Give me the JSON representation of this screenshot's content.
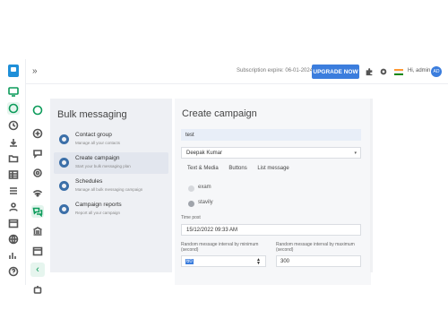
{
  "topbar": {
    "expand_icon": "double-chevron-right-icon",
    "subscription_text": "Subscription expire: 06-01-2024",
    "upgrade_label": "UPGRADE NOW",
    "greeting": "Hi, admin",
    "avatar_initials": "AD",
    "flag_colors": [
      "#ff9933",
      "#ffffff",
      "#138808"
    ]
  },
  "left_panel": {
    "title": "Bulk messaging",
    "items": [
      {
        "name": "Contact group",
        "desc": "Manage all your contacts"
      },
      {
        "name": "Create campaign",
        "desc": "Start your bulk messaging plan"
      },
      {
        "name": "Schedules",
        "desc": "Manage all bulk messaging campaign"
      },
      {
        "name": "Campaign reports",
        "desc": "Report all your campaign"
      }
    ]
  },
  "form": {
    "title": "Create campaign",
    "campaign_name": "test",
    "sender": "Deepak Kumar",
    "tabs": [
      "Text & Media",
      "Buttons",
      "List message"
    ],
    "templates": [
      "exam",
      "stavily"
    ],
    "time_post_label": "Time post",
    "time_post_value": "15/12/2022 09:33 AM",
    "min_label": "Random message interval by minimum (second)",
    "min_value": "60",
    "max_label": "Random message interval by maximum (second)",
    "max_value": "300"
  },
  "colors": {
    "accent": "#3b7ddd",
    "active_green": "#0c9b5a"
  }
}
